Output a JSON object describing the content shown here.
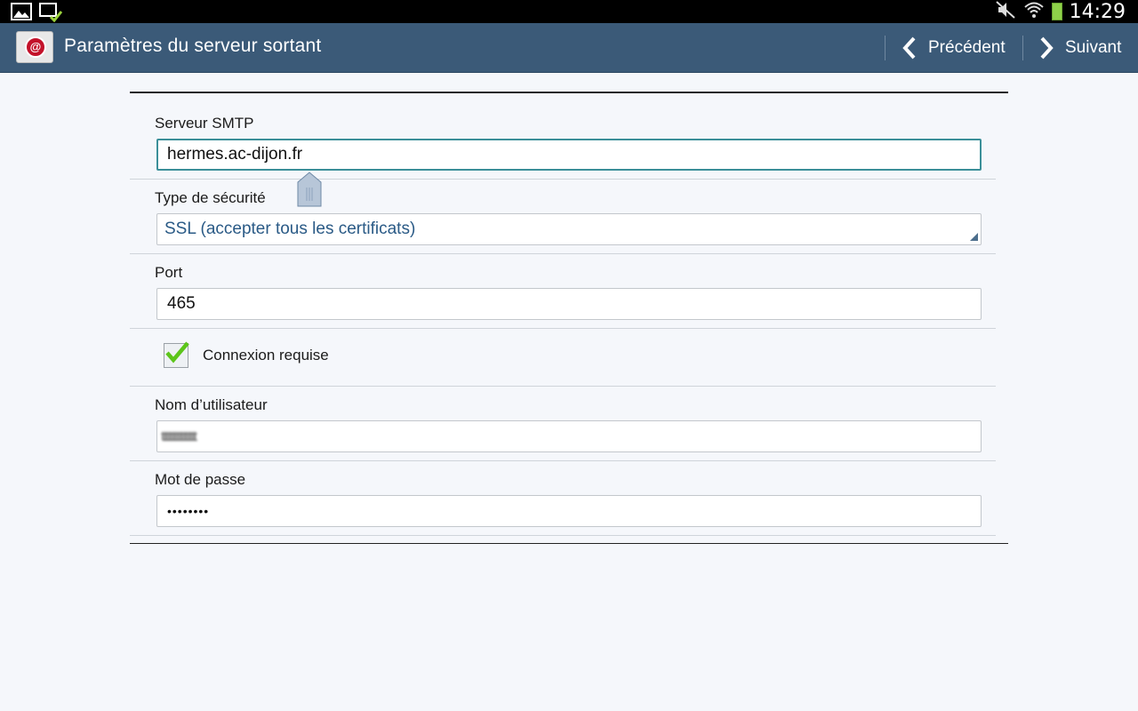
{
  "status_bar": {
    "time": "14:29",
    "icons_left": [
      "gallery-icon",
      "download-complete-icon"
    ],
    "icons_right": [
      "mute-icon",
      "wifi-icon",
      "battery-icon"
    ]
  },
  "action_bar": {
    "title": "Paramètres du serveur sortant",
    "prev_label": "Précédent",
    "next_label": "Suivant",
    "app_icon": "email-app-icon",
    "accent": "#3b5a78"
  },
  "form": {
    "smtp": {
      "label": "Serveur SMTP",
      "value": "hermes.ac-dijon.fr"
    },
    "security": {
      "label": "Type de sécurité",
      "value": "SSL (accepter tous les certificats)"
    },
    "port": {
      "label": "Port",
      "value": "465"
    },
    "login_required": {
      "label": "Connexion requise",
      "checked": true
    },
    "username": {
      "label": "Nom d’utilisateur",
      "value": "tttttttttttttttt"
    },
    "password": {
      "label": "Mot de passe",
      "value": "••••••••"
    }
  }
}
